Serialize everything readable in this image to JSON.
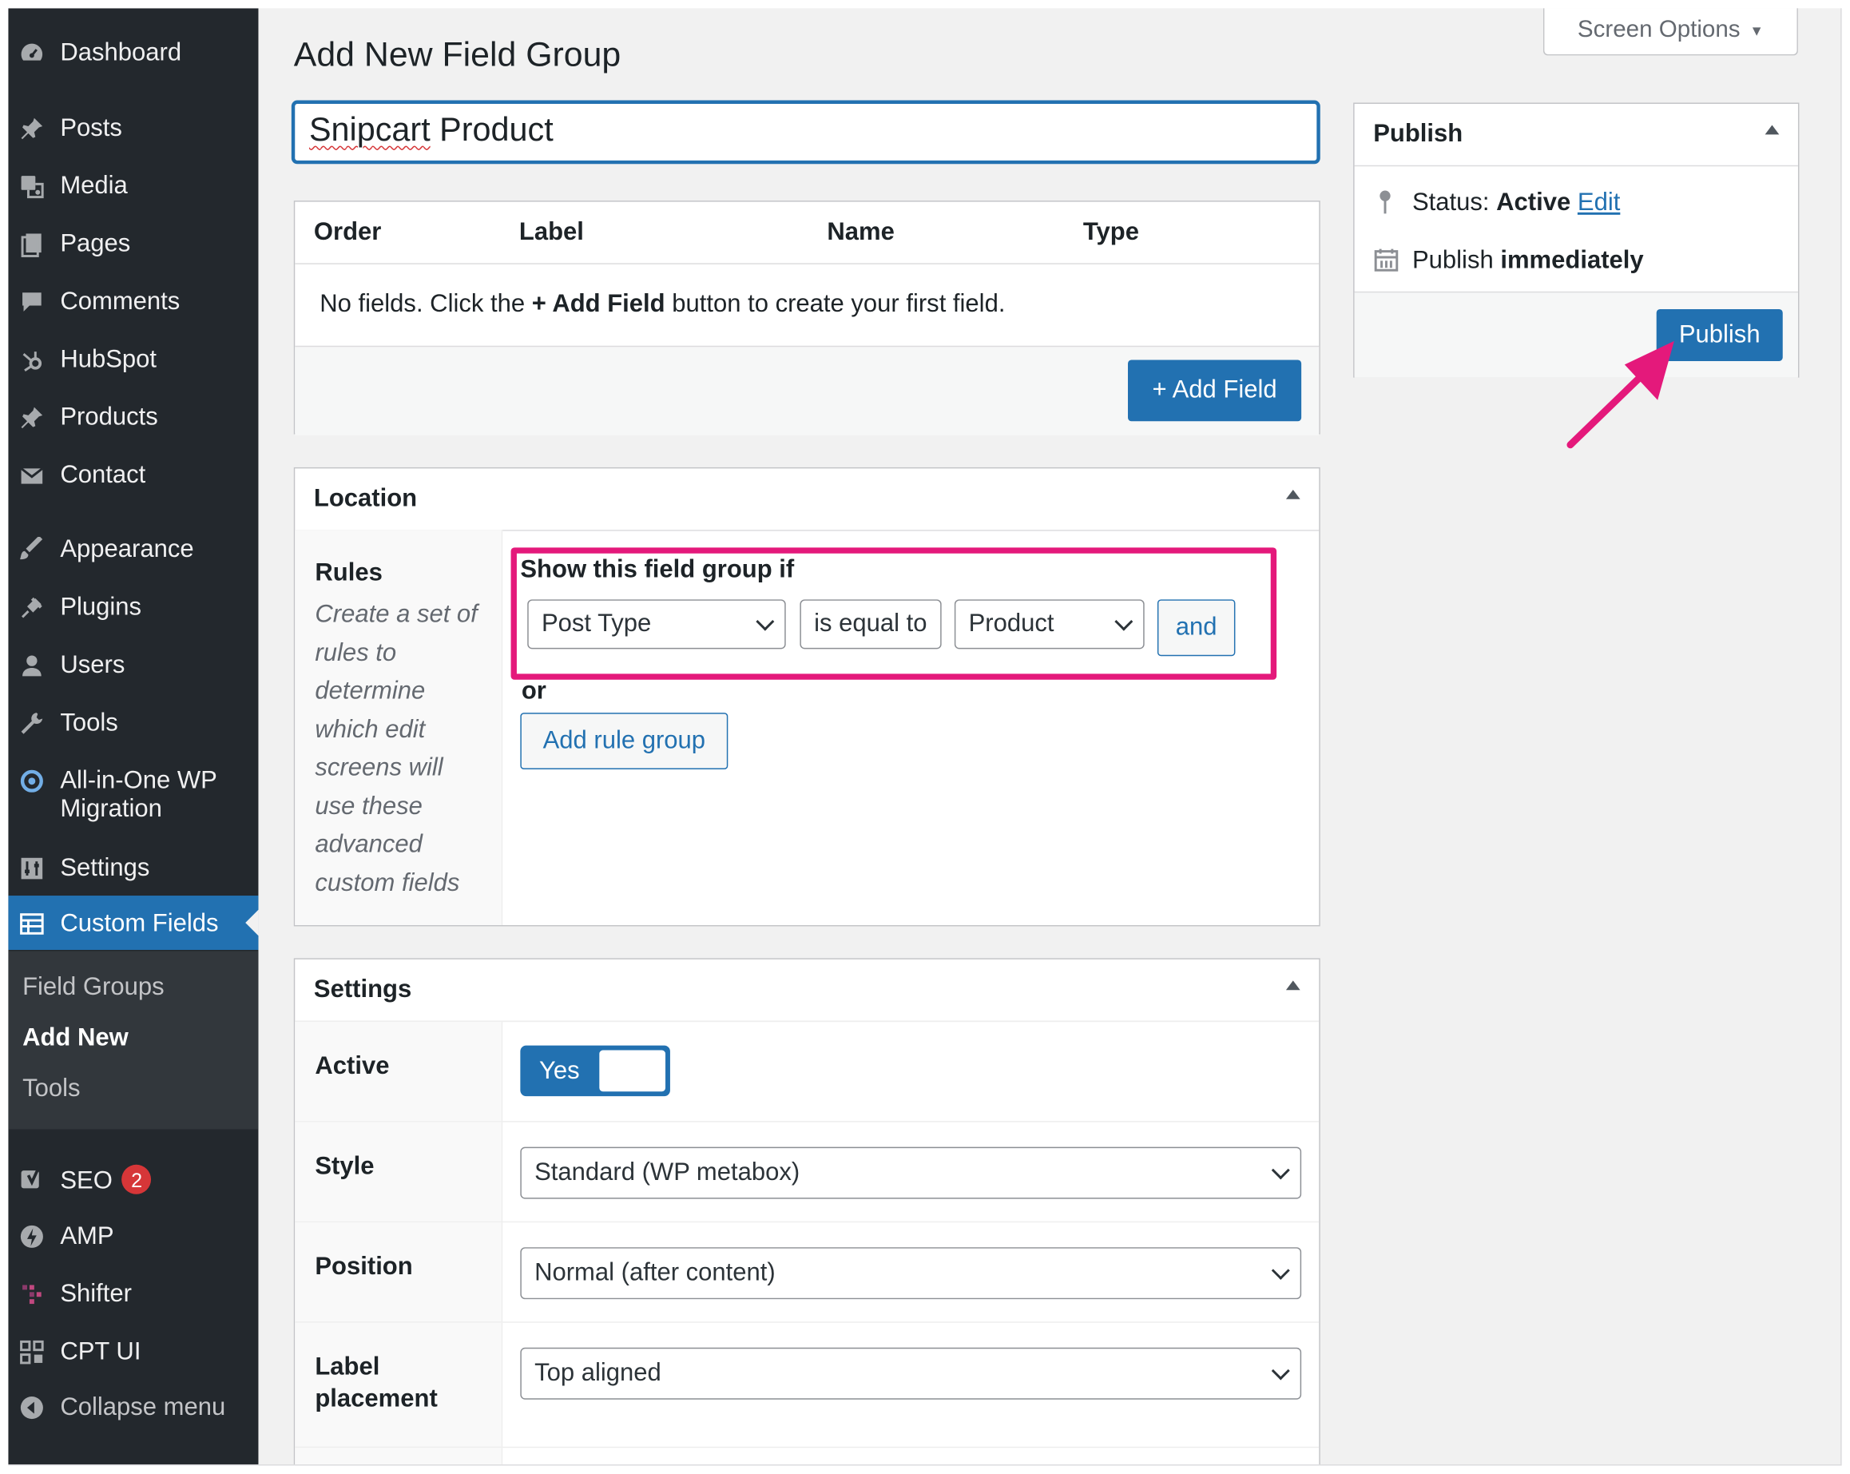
{
  "sidebar": {
    "items": [
      {
        "label": "Dashboard"
      },
      {
        "label": "Posts"
      },
      {
        "label": "Media"
      },
      {
        "label": "Pages"
      },
      {
        "label": "Comments"
      },
      {
        "label": "HubSpot"
      },
      {
        "label": "Products"
      },
      {
        "label": "Contact"
      },
      {
        "label": "Appearance"
      },
      {
        "label": "Plugins"
      },
      {
        "label": "Users"
      },
      {
        "label": "Tools"
      },
      {
        "label": "All-in-One WP Migration"
      },
      {
        "label": "Settings"
      },
      {
        "label": "Custom Fields",
        "active": true
      },
      {
        "label": "SEO",
        "badge": "2"
      },
      {
        "label": "AMP"
      },
      {
        "label": "Shifter"
      },
      {
        "label": "CPT UI"
      },
      {
        "label": "Collapse menu"
      }
    ],
    "submenu": [
      {
        "label": "Field Groups"
      },
      {
        "label": "Add New",
        "current": true
      },
      {
        "label": "Tools"
      }
    ]
  },
  "header": {
    "title": "Add New Field Group",
    "screen_options": "Screen Options"
  },
  "title_field": {
    "value_word1": "Snipcart",
    "value_rest": " Product"
  },
  "fields": {
    "columns": [
      "Order",
      "Label",
      "Name",
      "Type"
    ],
    "empty_prefix": "No fields. Click the ",
    "empty_bold": "+ Add Field",
    "empty_suffix": " button to create your first field.",
    "add_button": "+ Add Field"
  },
  "location": {
    "title": "Location",
    "rules_label": "Rules",
    "rules_description": "Create a set of rules to determine which edit screens will use these advanced custom fields",
    "show_if": "Show this field group if",
    "param": "Post Type",
    "operator": "is equal to",
    "value": "Product",
    "and_button": "and",
    "or_label": "or",
    "add_rule_group": "Add rule group"
  },
  "settings": {
    "title": "Settings",
    "active_label": "Active",
    "active_value": "Yes",
    "style_label": "Style",
    "style_value": "Standard (WP metabox)",
    "position_label": "Position",
    "position_value": "Normal (after content)",
    "label_placement_label": "Label placement",
    "label_placement_value": "Top aligned"
  },
  "publish": {
    "title": "Publish",
    "status_label": "Status:",
    "status_value": "Active",
    "edit_link": "Edit",
    "publish_label": "Publish",
    "publish_value": "immediately",
    "button": "Publish"
  },
  "colors": {
    "sidebar_bg": "#23282d",
    "accent": "#2271b1",
    "highlight": "#e4197b",
    "badge": "#d63638"
  },
  "icons": [
    "dashboard-icon",
    "pin-icon",
    "media-icon",
    "pages-icon",
    "comments-icon",
    "hubspot-icon",
    "products-icon",
    "mail-icon",
    "appearance-icon",
    "plugins-icon",
    "users-icon",
    "tools-icon",
    "migration-icon",
    "settings-icon",
    "custom-fields-icon",
    "seo-icon",
    "amp-icon",
    "shifter-icon",
    "cpt-ui-icon",
    "collapse-icon",
    "calendar-icon",
    "arrow-annotation"
  ]
}
